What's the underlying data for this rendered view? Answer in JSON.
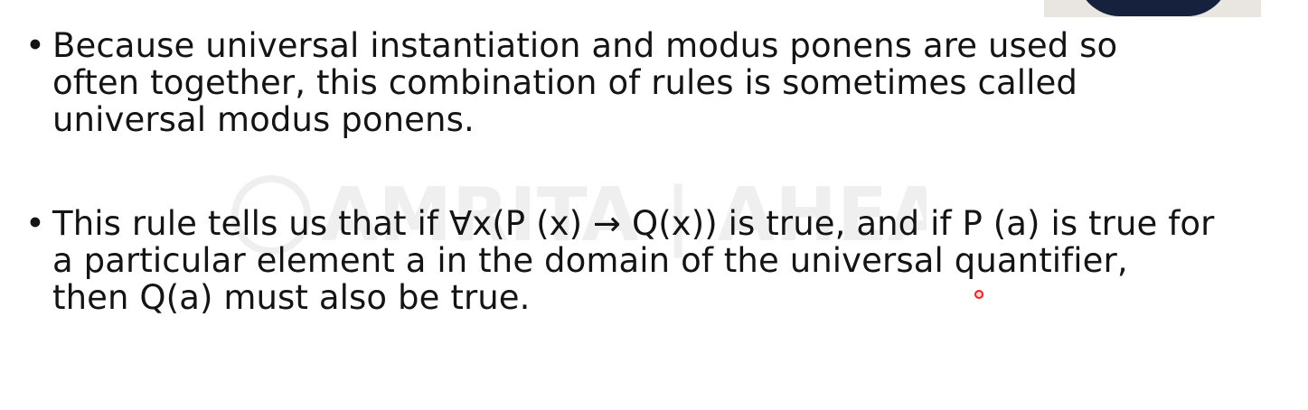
{
  "slide": {
    "bullets": [
      {
        "marker": "•",
        "lines": [
          "Because universal instantiation and modus ponens are used so",
          "often together, this combination of rules is sometimes called",
          "universal modus ponens."
        ]
      },
      {
        "marker": "•",
        "lines": [
          "This rule tells us that if ∀x(P (x) → Q(x)) is true, and if P (a) is true for",
          "a particular element a in the domain of the universal quantifier,",
          "then Q(a) must also be true."
        ]
      }
    ],
    "watermark_text": "AMRITA | AHEAD",
    "pointer_color": "#ff1b1b"
  }
}
